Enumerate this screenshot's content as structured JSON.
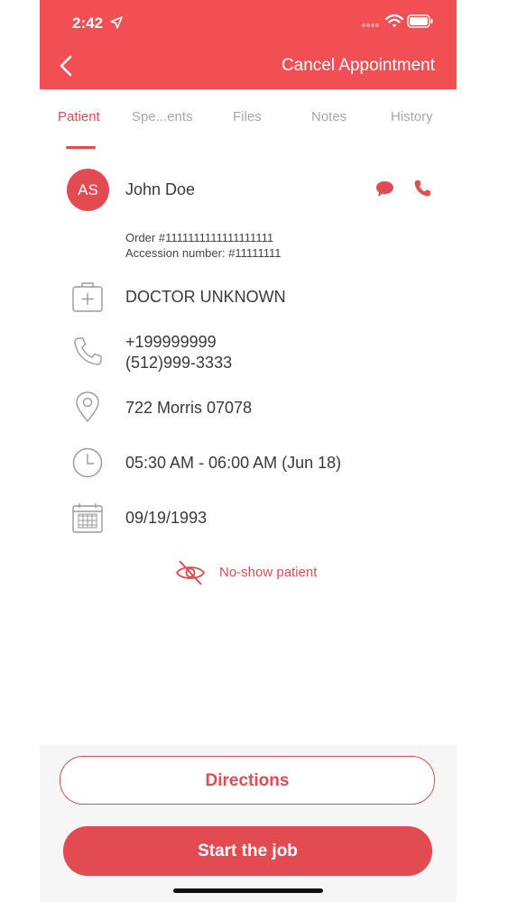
{
  "status_bar": {
    "time": "2:42"
  },
  "header": {
    "cancel_label": "Cancel Appointment"
  },
  "tabs": [
    {
      "label": "Patient",
      "active": true
    },
    {
      "label": "Spe...ents",
      "active": false
    },
    {
      "label": "Files",
      "active": false
    },
    {
      "label": "Notes",
      "active": false
    },
    {
      "label": "History",
      "active": false
    }
  ],
  "patient": {
    "initials": "AS",
    "name": "John Doe",
    "order": "Order #1111111111111111111",
    "accession": "Accession number: #11111111",
    "doctor": "DOCTOR UNKNOWN",
    "phone_1": "+199999999",
    "phone_2": "(512)999-3333",
    "address": "722 Morris 07078",
    "time_window": "05:30 AM - 06:00 AM (Jun 18)",
    "dob": "09/19/1993"
  },
  "no_show_label": "No-show patient",
  "actions": {
    "directions_label": "Directions",
    "start_label": "Start the job"
  },
  "colors": {
    "accent": "#e34b52",
    "header": "#f24f55",
    "icon_gray": "#9a9a9a"
  }
}
